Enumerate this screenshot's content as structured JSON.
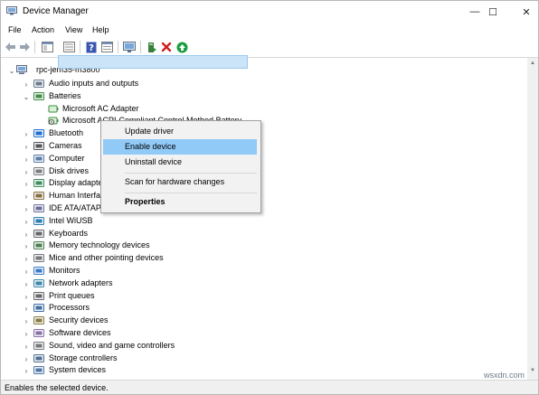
{
  "window": {
    "title": "Device Manager",
    "minimize": "—",
    "maximize": "☐",
    "close": "✕"
  },
  "menu": [
    "File",
    "Action",
    "View",
    "Help"
  ],
  "toolbar": [
    "back-icon",
    "forward-icon",
    "properties-view-icon",
    "hidden-devices-icon",
    "help-icon",
    "show-icon",
    "monitor-scan-icon",
    "update-driver-icon",
    "uninstall-icon",
    "enable-icon"
  ],
  "tree": {
    "root": "rpc-jem35-m3800",
    "categories": [
      {
        "label": "Audio inputs and outputs",
        "icon": "speaker-icon"
      },
      {
        "label": "Batteries",
        "icon": "battery-icon",
        "expanded": true,
        "children": [
          "Microsoft AC Adapter",
          "Microsoft ACPI-Compliant Control Method Battery"
        ]
      },
      {
        "label": "Bluetooth",
        "icon": "bluetooth-icon"
      },
      {
        "label": "Cameras",
        "icon": "camera-icon"
      },
      {
        "label": "Computer",
        "icon": "computer-icon"
      },
      {
        "label": "Disk drives",
        "icon": "disk-icon"
      },
      {
        "label": "Display adapte",
        "icon": "display-adapter-icon"
      },
      {
        "label": "Human Interfa",
        "icon": "hid-icon"
      },
      {
        "label": "IDE ATA/ATAPI c",
        "icon": "ide-icon"
      },
      {
        "label": "Intel WiUSB",
        "icon": "usb-icon"
      },
      {
        "label": "Keyboards",
        "icon": "keyboard-icon"
      },
      {
        "label": "Memory technology devices",
        "icon": "memory-icon"
      },
      {
        "label": "Mice and other pointing devices",
        "icon": "mouse-icon"
      },
      {
        "label": "Monitors",
        "icon": "monitor-icon"
      },
      {
        "label": "Network adapters",
        "icon": "network-icon"
      },
      {
        "label": "Print queues",
        "icon": "printer-icon"
      },
      {
        "label": "Processors",
        "icon": "processor-icon"
      },
      {
        "label": "Security devices",
        "icon": "security-icon"
      },
      {
        "label": "Software devices",
        "icon": "software-icon"
      },
      {
        "label": "Sound, video and game controllers",
        "icon": "sound-icon"
      },
      {
        "label": "Storage controllers",
        "icon": "storage-icon"
      },
      {
        "label": "System devices",
        "icon": "system-icon"
      }
    ]
  },
  "context_menu": {
    "items": [
      {
        "label": "Update driver"
      },
      {
        "label": "Enable device",
        "highlighted": true
      },
      {
        "label": "Uninstall device"
      },
      {
        "label": "Scan for hardware changes"
      },
      {
        "label": "Properties",
        "bold": true
      }
    ]
  },
  "status": {
    "text": "Enables the selected device."
  },
  "watermark": "wsxdn.com",
  "colors": {
    "selection": "#cce4f7",
    "menu_highlight": "#91c9f7",
    "accent_green": "#1a9e3f",
    "accent_red": "#d11f1f",
    "help_blue": "#3a56b0"
  }
}
